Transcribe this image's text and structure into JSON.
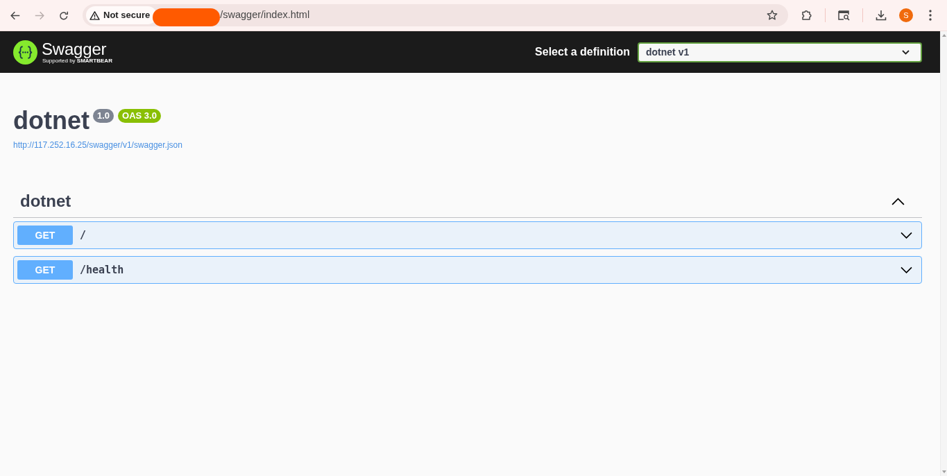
{
  "browser": {
    "nav_buttons": [
      {
        "kind": "back",
        "disabled": false
      },
      {
        "kind": "forward",
        "disabled": true
      },
      {
        "kind": "reload",
        "disabled": false
      }
    ],
    "security_label": "Not secure",
    "address": "/swagger/index.html",
    "profile_initial": "S"
  },
  "topbar": {
    "brand": "Swagger",
    "tagline": "Supported by **SMARTBEAR**",
    "definition_label": "Select a definition",
    "definition_value": "dotnet v1"
  },
  "info": {
    "title": "dotnet",
    "version": "1.0",
    "oas_version": "OAS 3.0",
    "spec_url": "http://117.252.16.25/swagger/v1/swagger.json"
  },
  "tags": [
    {
      "name": "dotnet",
      "expanded": true,
      "operations": [
        {
          "kind": "get",
          "method": "GET",
          "path": "/",
          "expanded": false
        },
        {
          "kind": "get",
          "method": "GET",
          "path": "/health",
          "expanded": false
        }
      ]
    }
  ]
}
